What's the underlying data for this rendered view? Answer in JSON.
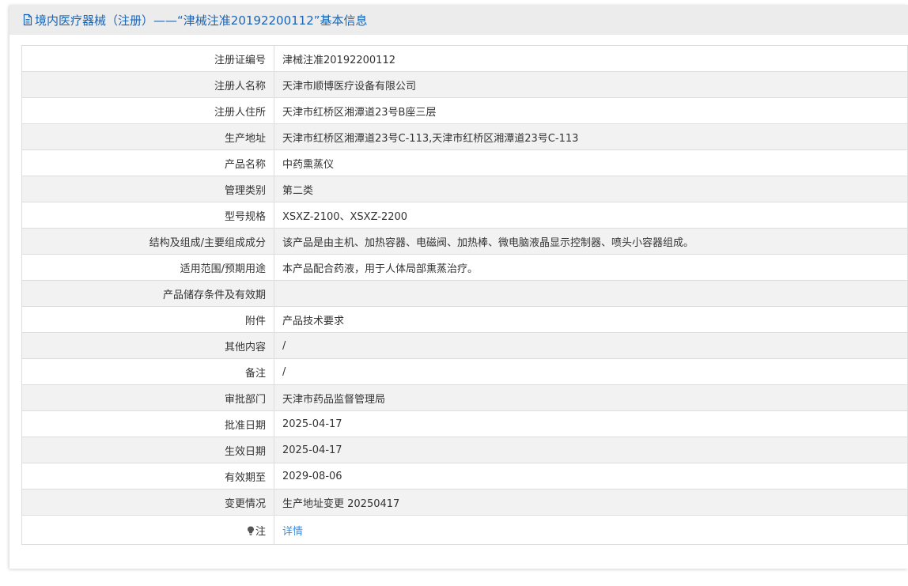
{
  "header": {
    "title": "境内医疗器械（注册）——“津械注准20192200112”基本信息",
    "icon": "document-icon"
  },
  "rows": [
    {
      "label": "注册证编号",
      "value": "津械注准20192200112"
    },
    {
      "label": "注册人名称",
      "value": "天津市顺博医疗设备有限公司"
    },
    {
      "label": "注册人住所",
      "value": "天津市红桥区湘潭道23号B座三层"
    },
    {
      "label": "生产地址",
      "value": "天津市红桥区湘潭道23号C-113,天津市红桥区湘潭道23号C-113"
    },
    {
      "label": "产品名称",
      "value": "中药熏蒸仪"
    },
    {
      "label": "管理类别",
      "value": "第二类"
    },
    {
      "label": "型号规格",
      "value": "XSXZ-2100、XSXZ-2200"
    },
    {
      "label": "结构及组成/主要组成成分",
      "value": "该产品是由主机、加热容器、电磁阀、加热棒、微电脑液晶显示控制器、喷头小容器组成。"
    },
    {
      "label": "适用范围/预期用途",
      "value": "本产品配合药液，用于人体局部熏蒸治疗。"
    },
    {
      "label": "产品储存条件及有效期",
      "value": ""
    },
    {
      "label": "附件",
      "value": "产品技术要求"
    },
    {
      "label": "其他内容",
      "value": "/"
    },
    {
      "label": "备注",
      "value": "/"
    },
    {
      "label": "审批部门",
      "value": "天津市药品监督管理局"
    },
    {
      "label": "批准日期",
      "value": "2025-04-17"
    },
    {
      "label": "生效日期",
      "value": "2025-04-17"
    },
    {
      "label": "有效期至",
      "value": "2029-08-06"
    },
    {
      "label": "变更情况",
      "value": "生产地址变更 20250417"
    }
  ],
  "note_row": {
    "label": "注",
    "icon": "lightbulb-icon",
    "link_text": "详情"
  },
  "colors": {
    "title_color": "#1a64b4",
    "link_color": "#3a8ee6",
    "header_bg": "#ececec",
    "alt_row_bg": "#f2f2f2",
    "border": "#dddddd"
  }
}
